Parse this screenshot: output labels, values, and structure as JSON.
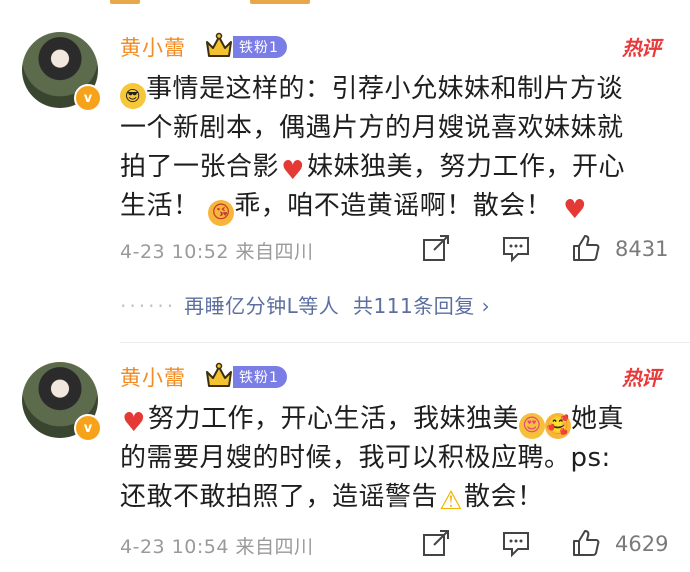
{
  "comments": [
    {
      "username": "黄小蕾",
      "fan_badge": "铁粉1",
      "hot_label": "热评",
      "verified": "v",
      "lines": [
        "事情是这样的：引荐小允妹妹和制片方谈",
        "一个新剧本，偶遇片方的月嫂说喜欢妹妹就",
        "拍了一张合影",
        "妹妹独美，努力工作，开心",
        "生活！",
        "乖，咱不造黄谣啊！散会！"
      ],
      "time": "4-23 10:52",
      "source": "来自四川",
      "likes": "8431",
      "replies_text": "再睡亿分钟L等人",
      "replies_count": "共111条回复",
      "replies_arrow": "›"
    },
    {
      "username": "黄小蕾",
      "fan_badge": "铁粉1",
      "hot_label": "热评",
      "verified": "v",
      "lines": [
        "努力工作，开心生活，我妹独美",
        "她真",
        "的需要月嫂的时候，我可以积极应聘。ps:",
        "还敢不敢拍照了，造谣警告",
        "散会！"
      ],
      "time": "4-23 10:54",
      "source": "来自四川",
      "likes": "4629"
    }
  ],
  "icons": {
    "sunglasses": "sunglasses-emoji-icon",
    "heart": "red-heart-icon",
    "kiss": "blowing-kiss-emoji-icon",
    "heart_eyes": "heart-eyes-emoji-icon",
    "hug": "smiling-hearts-emoji-icon",
    "warning": "warning-icon",
    "repost": "repost-icon",
    "comment": "comment-icon",
    "like": "thumbs-up-icon"
  },
  "colors": {
    "username": "#f28c25",
    "fan_badge_bg": "#7b7de6",
    "hot": "#e83a3a",
    "reply_link": "#5c6fa0",
    "meta": "#9a9a9a"
  }
}
